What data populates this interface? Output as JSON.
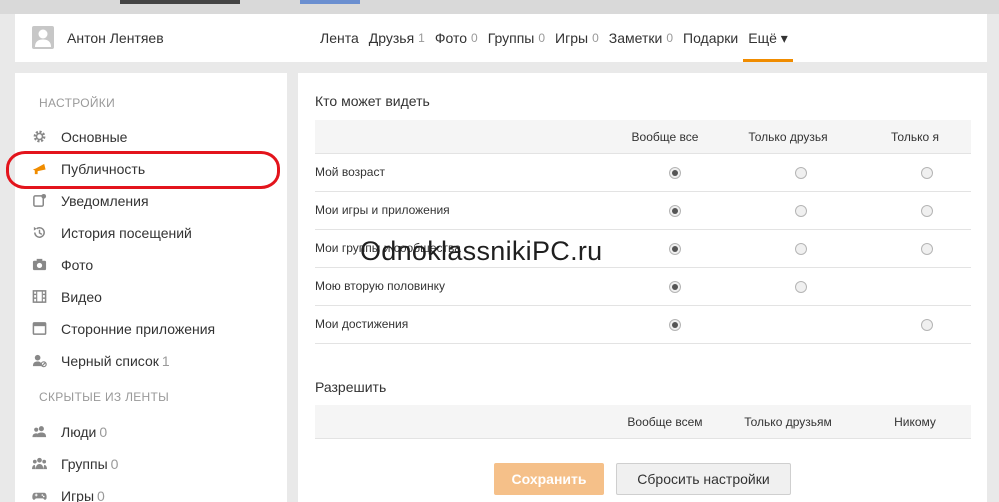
{
  "header": {
    "user_name": "Антон Лентяев",
    "nav": [
      {
        "label": "Лента",
        "count": ""
      },
      {
        "label": "Друзья",
        "count": "1"
      },
      {
        "label": "Фото",
        "count": "0"
      },
      {
        "label": "Группы",
        "count": "0"
      },
      {
        "label": "Игры",
        "count": "0"
      },
      {
        "label": "Заметки",
        "count": "0"
      },
      {
        "label": "Подарки",
        "count": ""
      },
      {
        "label": "Ещё ▾",
        "count": ""
      }
    ],
    "active_nav": "Ещё ▾",
    "accent_color": "#f08c00"
  },
  "sidebar": {
    "settings_heading": "НАСТРОЙКИ",
    "items": [
      {
        "label": "Основные",
        "count": "",
        "icon": "gear-icon"
      },
      {
        "label": "Публичность",
        "count": "",
        "icon": "megaphone-icon"
      },
      {
        "label": "Уведомления",
        "count": "",
        "icon": "notification-icon"
      },
      {
        "label": "История посещений",
        "count": "",
        "icon": "history-icon"
      },
      {
        "label": "Фото",
        "count": "",
        "icon": "camera-icon"
      },
      {
        "label": "Видео",
        "count": "",
        "icon": "film-icon"
      },
      {
        "label": "Сторонние приложения",
        "count": "",
        "icon": "app-window-icon"
      },
      {
        "label": "Черный список",
        "count": "1",
        "icon": "blocked-user-icon"
      }
    ],
    "hidden_heading": "СКРЫТЫЕ ИЗ ЛЕНТЫ",
    "hidden_items": [
      {
        "label": "Люди",
        "count": "0",
        "icon": "people-icon"
      },
      {
        "label": "Группы",
        "count": "0",
        "icon": "group-icon"
      },
      {
        "label": "Игры",
        "count": "0",
        "icon": "gamepad-icon"
      }
    ],
    "active_item": "Публичность",
    "highlight_color": "#e3141c"
  },
  "visibility": {
    "title": "Кто может видеть",
    "columns": [
      "Вообще все",
      "Только друзья",
      "Только я"
    ],
    "rows": [
      {
        "label": "Мой возраст",
        "options": [
          true,
          true,
          true
        ],
        "selected": 0
      },
      {
        "label": "Мои игры и приложения",
        "options": [
          true,
          true,
          true
        ],
        "selected": 0
      },
      {
        "label": "Мои группы и сообщества",
        "options": [
          true,
          true,
          true
        ],
        "selected": 0
      },
      {
        "label": "Мою вторую половинку",
        "options": [
          true,
          true,
          false
        ],
        "selected": 0
      },
      {
        "label": "Мои достижения",
        "options": [
          true,
          false,
          true
        ],
        "selected": 0
      }
    ]
  },
  "allow": {
    "title": "Разрешить",
    "columns": [
      "Вообще всем",
      "Только друзьям",
      "Никому"
    ]
  },
  "buttons": {
    "save": "Сохранить",
    "reset": "Сбросить настройки"
  },
  "watermark": "OdnoklassnikiPC.ru"
}
